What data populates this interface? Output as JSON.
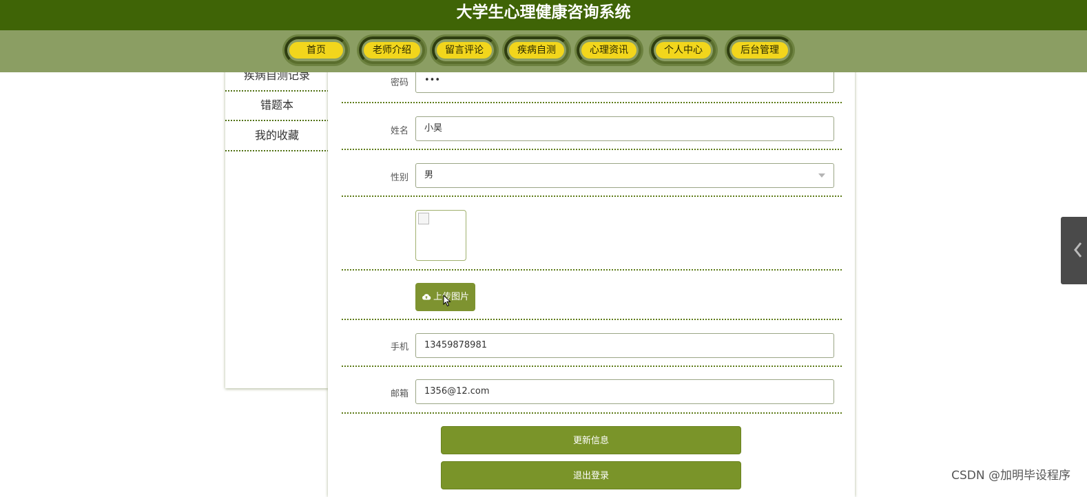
{
  "header": {
    "title": "大学生心理健康咨询系统"
  },
  "nav": {
    "items": [
      {
        "label": "首页"
      },
      {
        "label": "老师介绍"
      },
      {
        "label": "留言评论"
      },
      {
        "label": "疾病自测"
      },
      {
        "label": "心理资讯"
      },
      {
        "label": "个人中心"
      },
      {
        "label": "后台管理"
      }
    ]
  },
  "sidebar": {
    "items": [
      {
        "label": "疾病自测记录"
      },
      {
        "label": "错题本"
      },
      {
        "label": "我的收藏"
      }
    ]
  },
  "form": {
    "password": {
      "label": "密码",
      "value": "•••"
    },
    "name": {
      "label": "姓名",
      "value": "小昊"
    },
    "gender": {
      "label": "性别",
      "value": "男"
    },
    "upload_label": "上传图片",
    "phone": {
      "label": "手机",
      "value": "13459878981"
    },
    "email": {
      "label": "邮箱",
      "value": "1356@12.com"
    },
    "update_button": "更新信息",
    "logout_button": "退出登录"
  },
  "watermark": "CSDN @加明毕设程序",
  "colors": {
    "header_bg": "#3f6406",
    "nav_bg": "#8b9e63",
    "nav_pill": "#f2d61c",
    "button_green": "#7a9429"
  }
}
